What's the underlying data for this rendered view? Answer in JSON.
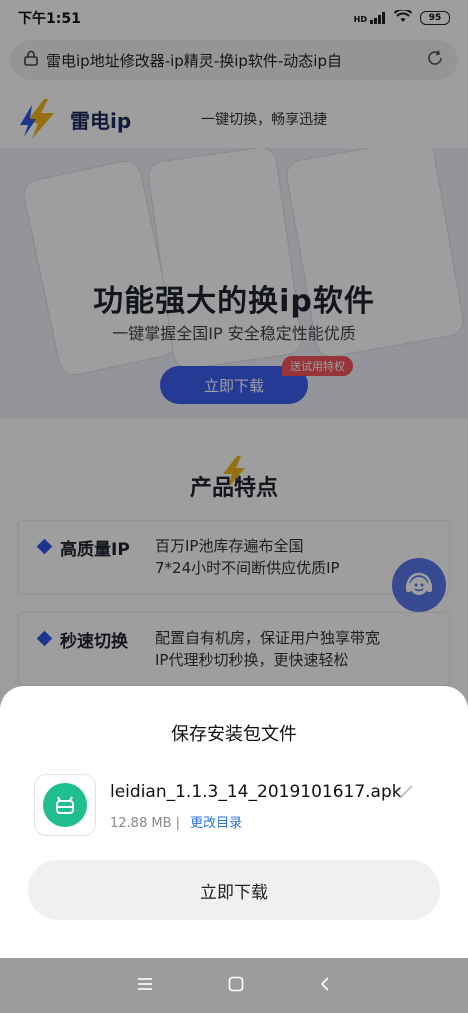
{
  "status_bar": {
    "time": "下午1:51",
    "signal_label": "HD",
    "battery": "95"
  },
  "browser": {
    "url_text": "雷电ip地址修改器-ip精灵-换ip软件-动态ip自"
  },
  "site": {
    "logo_text": "雷电ip",
    "slogan": "一键切换，畅享迅捷",
    "hero_title": "功能强大的换ip软件",
    "hero_subtitle": "一键掌握全国IP  安全稳定性能优质",
    "hero_button": "立即下载",
    "hero_badge": "送试用特权",
    "features_title": "产品特点",
    "features": [
      {
        "name": "高质量IP",
        "desc_line1": "百万IP池库存遍布全国",
        "desc_line2": "7*24小时不间断供应优质IP"
      },
      {
        "name": "秒速切换",
        "desc_line1": "配置自有机房，保证用户独享带宽",
        "desc_line2": "IP代理秒切秒换，更快速轻松"
      }
    ]
  },
  "dialog": {
    "title": "保存安装包文件",
    "file_name": "leidian_1.1.3_14_2019101617.apk",
    "file_size": "12.88 MB",
    "separator": "|",
    "change_dir": "更改目录",
    "download_button": "立即下载"
  },
  "colors": {
    "accent_blue": "#3a5ef0",
    "badge_red": "#f2545b",
    "apk_green": "#1fbf8f",
    "link_blue": "#2a72e0"
  }
}
